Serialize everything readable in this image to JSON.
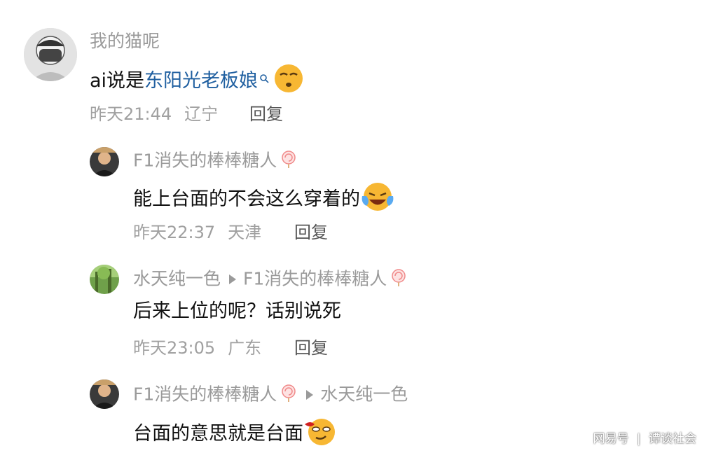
{
  "comments": [
    {
      "user": "我的猫呢",
      "text_prefix": "ai说是",
      "link": "东阳光老板娘",
      "time": "昨天21:44",
      "location": "辽宁",
      "reply_label": "回复",
      "emoji": "sleepy-face-emoji"
    },
    {
      "user": "F1消失的棒棒糖人",
      "text": "能上台面的不会这么穿着的",
      "time": "昨天22:37",
      "location": "天津",
      "reply_label": "回复",
      "emoji": "crying-laughing-emoji"
    },
    {
      "user": "水天纯一色",
      "reply_to": "F1消失的棒棒糖人",
      "text": "后来上位的呢？话别说死",
      "time": "昨天23:05",
      "location": "广东",
      "reply_label": "回复"
    },
    {
      "user": "F1消失的棒棒糖人",
      "reply_to": "水天纯一色",
      "text": "台面的意思就是台面",
      "emoji": "smirk-face-emoji"
    }
  ],
  "watermark": {
    "source": "网易号",
    "author": "谭谈社会"
  },
  "colors": {
    "link": "#1f5fa0",
    "username": "#9a9a9a",
    "meta": "#a0a0a0"
  }
}
